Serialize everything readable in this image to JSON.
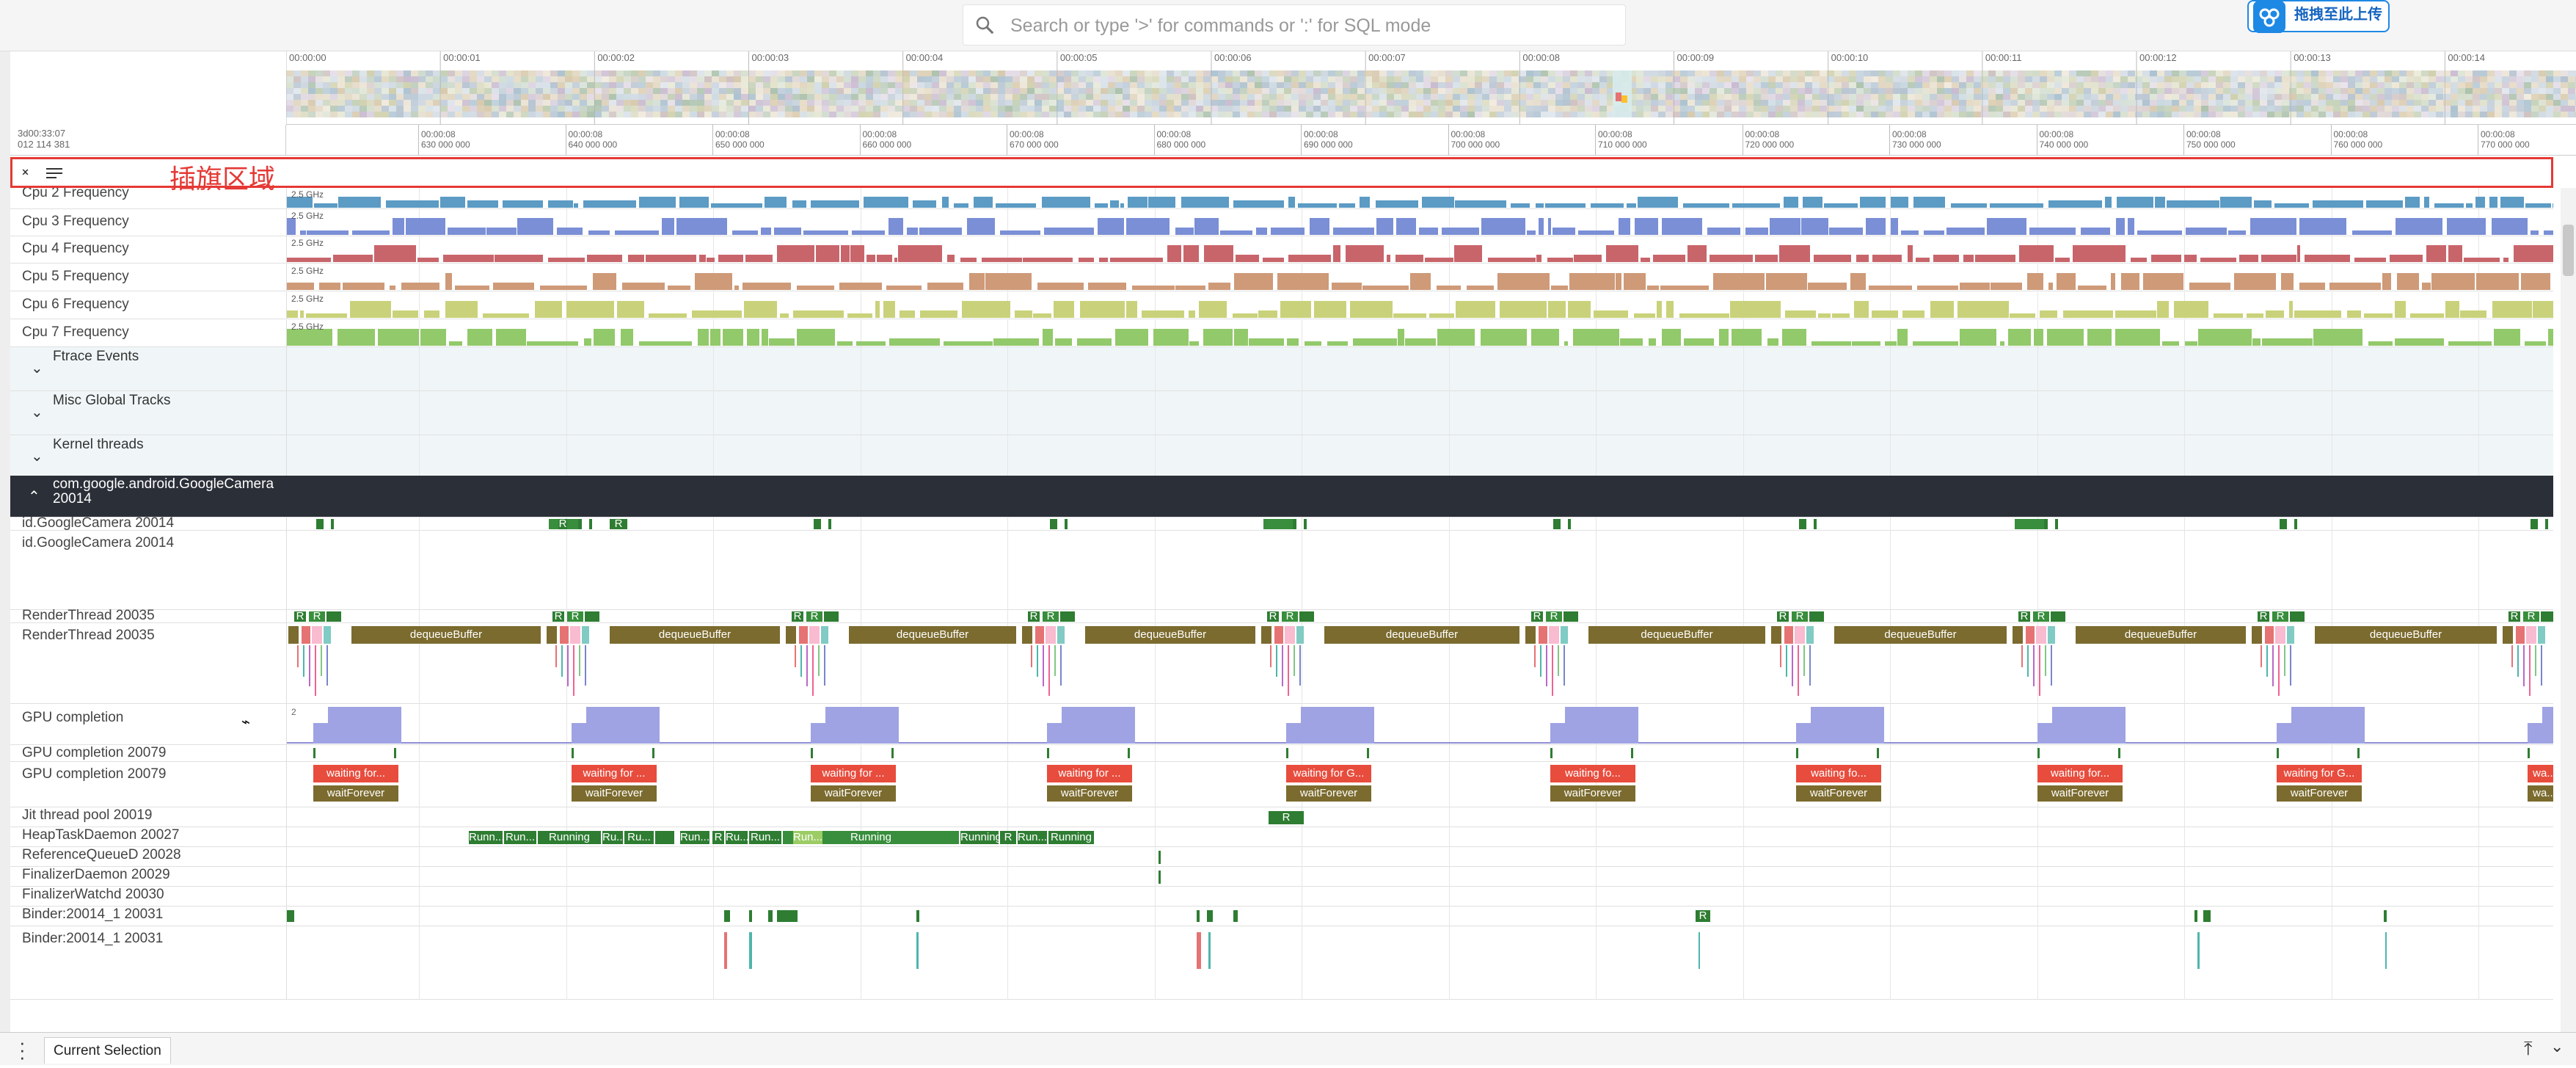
{
  "search": {
    "placeholder": "Search or type '>' for commands or ':' for SQL mode"
  },
  "upload_button": {
    "label": "拖拽至此上传"
  },
  "timeline": {
    "offset_label": "3d00:33:07",
    "offset_value": "012 114 381",
    "overview_ticks": [
      "00:00:00",
      "00:00:01",
      "00:00:02",
      "00:00:03",
      "00:00:04",
      "00:00:05",
      "00:00:06",
      "00:00:07",
      "00:00:08",
      "00:00:09",
      "00:00:10",
      "00:00:11",
      "00:00:12",
      "00:00:13",
      "00:00:14"
    ],
    "ruler_ticks": [
      {
        "top": "00:00:08",
        "bottom": "630 000 000"
      },
      {
        "top": "00:00:08",
        "bottom": "640 000 000"
      },
      {
        "top": "00:00:08",
        "bottom": "650 000 000"
      },
      {
        "top": "00:00:08",
        "bottom": "660 000 000"
      },
      {
        "top": "00:00:08",
        "bottom": "670 000 000"
      },
      {
        "top": "00:00:08",
        "bottom": "680 000 000"
      },
      {
        "top": "00:00:08",
        "bottom": "690 000 000"
      },
      {
        "top": "00:00:08",
        "bottom": "700 000 000"
      },
      {
        "top": "00:00:08",
        "bottom": "710 000 000"
      },
      {
        "top": "00:00:08",
        "bottom": "720 000 000"
      },
      {
        "top": "00:00:08",
        "bottom": "730 000 000"
      },
      {
        "top": "00:00:08",
        "bottom": "740 000 000"
      },
      {
        "top": "00:00:08",
        "bottom": "750 000 000"
      },
      {
        "top": "00:00:08",
        "bottom": "760 000 000"
      },
      {
        "top": "00:00:08",
        "bottom": "770 000 000"
      }
    ]
  },
  "flag_area": {
    "label": "插旗区域"
  },
  "cpu_tracks": [
    {
      "name": "Cpu 2 Frequency",
      "freq": "2.5 GHz",
      "color": "#5b9bc4"
    },
    {
      "name": "Cpu 3 Frequency",
      "freq": "2.5 GHz",
      "color": "#7b8fd6"
    },
    {
      "name": "Cpu 4 Frequency",
      "freq": "2.5 GHz",
      "color": "#c8656b"
    },
    {
      "name": "Cpu 5 Frequency",
      "freq": "2.5 GHz",
      "color": "#cf9a78"
    },
    {
      "name": "Cpu 6 Frequency",
      "freq": "2.5 GHz",
      "color": "#c9d27a"
    },
    {
      "name": "Cpu 7 Frequency",
      "freq": "2.5 GHz",
      "color": "#92c96a"
    }
  ],
  "groups": [
    "Ftrace Events",
    "Misc Global Tracks",
    "Kernel threads"
  ],
  "process": {
    "name": "com.google.android.GoogleCamera 20014"
  },
  "threads": {
    "main1": "id.GoogleCamera 20014",
    "main2": "id.GoogleCamera 20014",
    "render1": "RenderThread 20035",
    "render2": "RenderThread 20035",
    "gpu_counter": "GPU completion",
    "gpu_counter_max": "2",
    "gpu1": "GPU completion 20079",
    "gpu2": "GPU completion 20079",
    "jit": "Jit thread pool 20019",
    "heap": "HeapTaskDaemon 20027",
    "refq": "ReferenceQueueD 20028",
    "finalizer": "FinalizerDaemon 20029",
    "finwatch": "FinalizerWatchd 20030",
    "binder1": "Binder:20014_1 20031",
    "binder2": "Binder:20014_1 20031"
  },
  "slices": {
    "dequeue": "dequeueBuffer",
    "waiting_labels": [
      "waiting for...",
      "waiting for ...",
      "waiting for ...",
      "waiting for ...",
      "waiting for G...",
      "waiting fo...",
      "waiting fo...",
      "waiting for...",
      "waiting for G...",
      "wa..."
    ],
    "wait_forever": "waitForever",
    "wait_forever_short": "wa...",
    "running": "Running",
    "runn_short": "Runn...",
    "run_short": "Run...",
    "ru_short": "Ru...",
    "r": "R",
    "ru": "Ru..."
  },
  "bottom": {
    "tab": "Current Selection"
  }
}
